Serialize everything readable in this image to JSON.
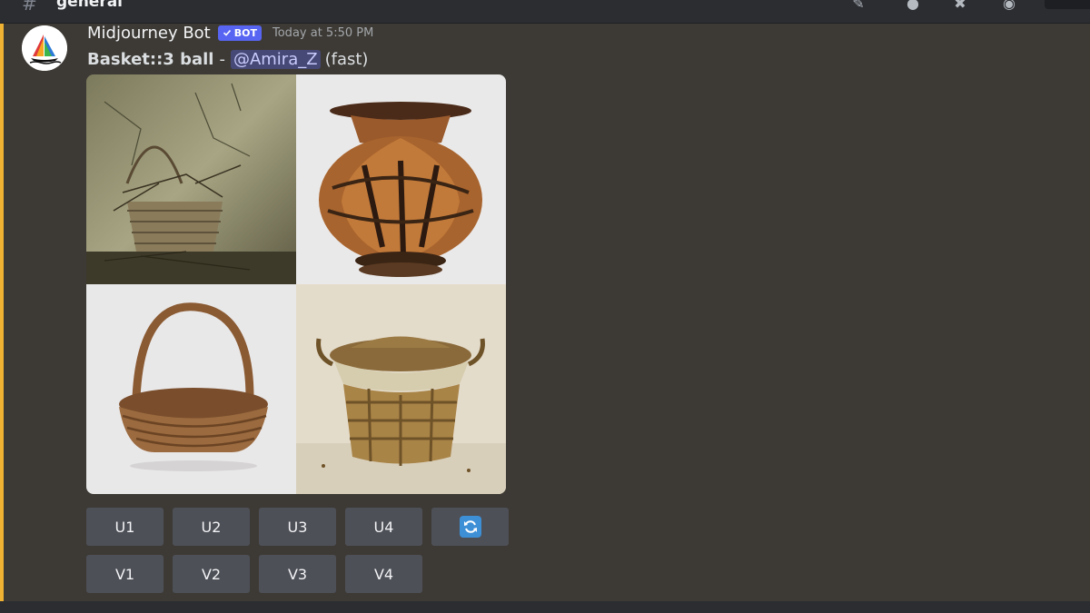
{
  "channel": {
    "name": "general"
  },
  "message": {
    "username": "Midjourney Bot",
    "bot_tag": "BOT",
    "timestamp": "Today at 5:50 PM",
    "prompt": "Basket::3 ball",
    "separator": "-",
    "mention": "@Amira_Z",
    "speed": "(fast)"
  },
  "buttons": {
    "upscale": [
      "U1",
      "U2",
      "U3",
      "U4"
    ],
    "variation": [
      "V1",
      "V2",
      "V3",
      "V4"
    ]
  },
  "colors": {
    "accent": "#f0b232",
    "bot_tag": "#5865f2",
    "button": "#4e5058",
    "refresh": "#3d8fd6"
  },
  "icons": {
    "verified": "checkmark-icon",
    "reroll": "refresh-icon"
  }
}
